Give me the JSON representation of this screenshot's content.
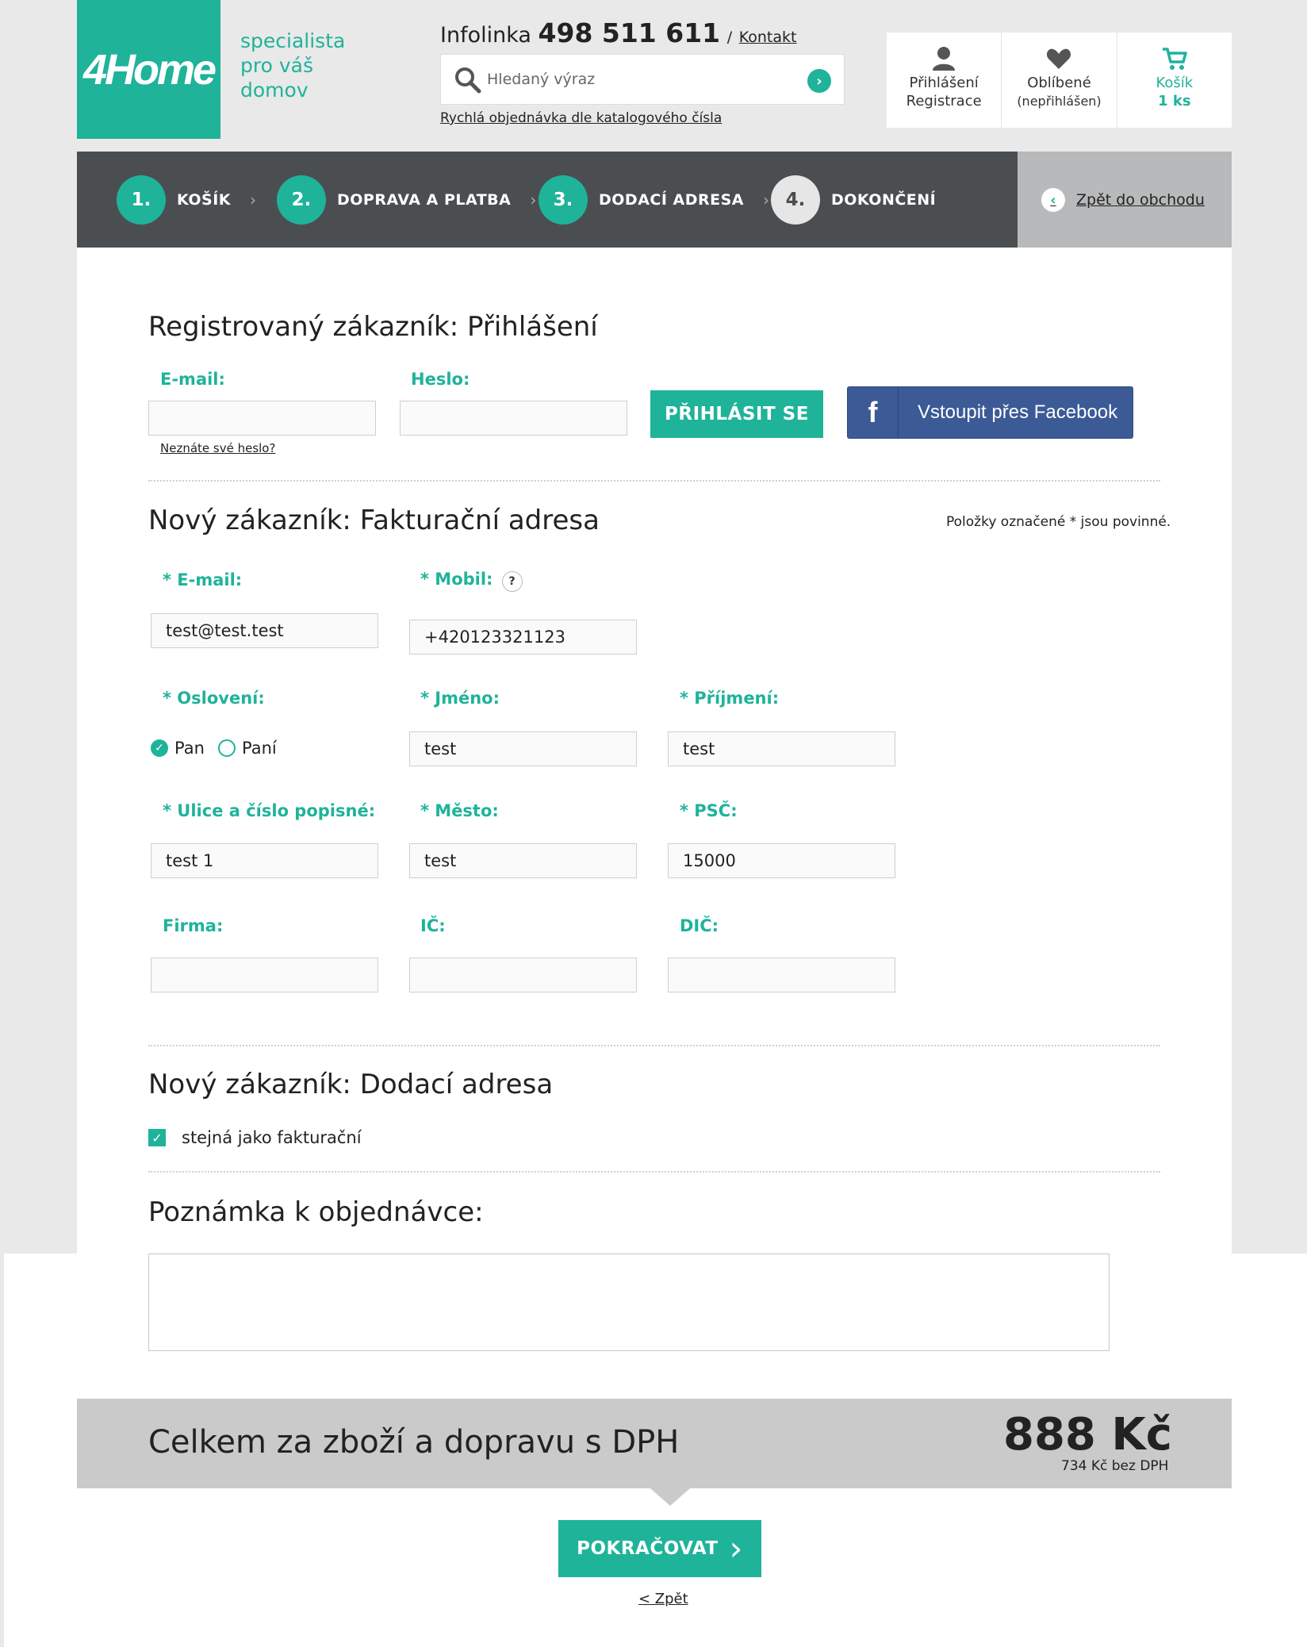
{
  "header": {
    "logo_text": "4Home",
    "tagline": [
      "specialista",
      "pro váš",
      "domov"
    ],
    "infolinka_label": "Infolinka",
    "infolinka_phone": "498 511 611",
    "infolinka_sep": "/",
    "contact_link": "Kontakt",
    "search_placeholder": "Hledaný výraz",
    "quick_order_link": "Rychlá objednávka dle katalogového čísla",
    "user": {
      "login": "Přihlášení",
      "register": "Registrace"
    },
    "favorites": {
      "label": "Oblíbené",
      "status": "(nepřihlášen)"
    },
    "cart": {
      "label": "Košík",
      "count": "1 ks"
    }
  },
  "steps": [
    {
      "num": "1.",
      "label": "KOŠÍK"
    },
    {
      "num": "2.",
      "label": "DOPRAVA A PLATBA"
    },
    {
      "num": "3.",
      "label": "DODACÍ ADRESA"
    },
    {
      "num": "4.",
      "label": "DOKONČENÍ"
    }
  ],
  "back_to_shop": "Zpět do obchodu",
  "login_section": {
    "title": "Registrovaný zákazník: Přihlášení",
    "email_label": "E-mail:",
    "password_label": "Heslo:",
    "forgot_link": "Neznáte své heslo?",
    "login_button": "PŘIHLÁSIT SE",
    "facebook_button": "Vstoupit přes Facebook"
  },
  "billing_section": {
    "title": "Nový zákazník: Fakturační adresa",
    "required_note": "Položky označené * jsou povinné.",
    "email_label": "* E-mail:",
    "email_value": "test@test.test",
    "mobile_label": "* Mobil:",
    "mobile_help": "?",
    "mobile_value": "+420123321123",
    "salutation_label": "* Oslovení:",
    "salutation_options": [
      "Pan",
      "Paní"
    ],
    "salutation_selected": "Pan",
    "firstname_label": "* Jméno:",
    "firstname_value": "test",
    "lastname_label": "* Příjmení:",
    "lastname_value": "test",
    "street_label": "* Ulice a číslo popisné:",
    "street_value": "test 1",
    "city_label": "* Město:",
    "city_value": "test",
    "zip_label": "* PSČ:",
    "zip_value": "15000",
    "company_label": "Firma:",
    "ic_label": "IČ:",
    "dic_label": "DIČ:"
  },
  "delivery_section": {
    "title": "Nový zákazník: Dodací adresa",
    "same_as_billing": "stejná jako fakturační",
    "same_checked": true
  },
  "note_section": {
    "title": "Poznámka k objednávce:"
  },
  "total": {
    "label": "Celkem za zboží a dopravu s DPH",
    "price": "888 Kč",
    "net": "734 Kč bez DPH"
  },
  "continue_button": "POKRAČOVAT",
  "back_link": "< Zpět",
  "colors": {
    "accent": "#1fb39a",
    "dark_bar": "#4b4e51",
    "facebook": "#3b5a96"
  }
}
